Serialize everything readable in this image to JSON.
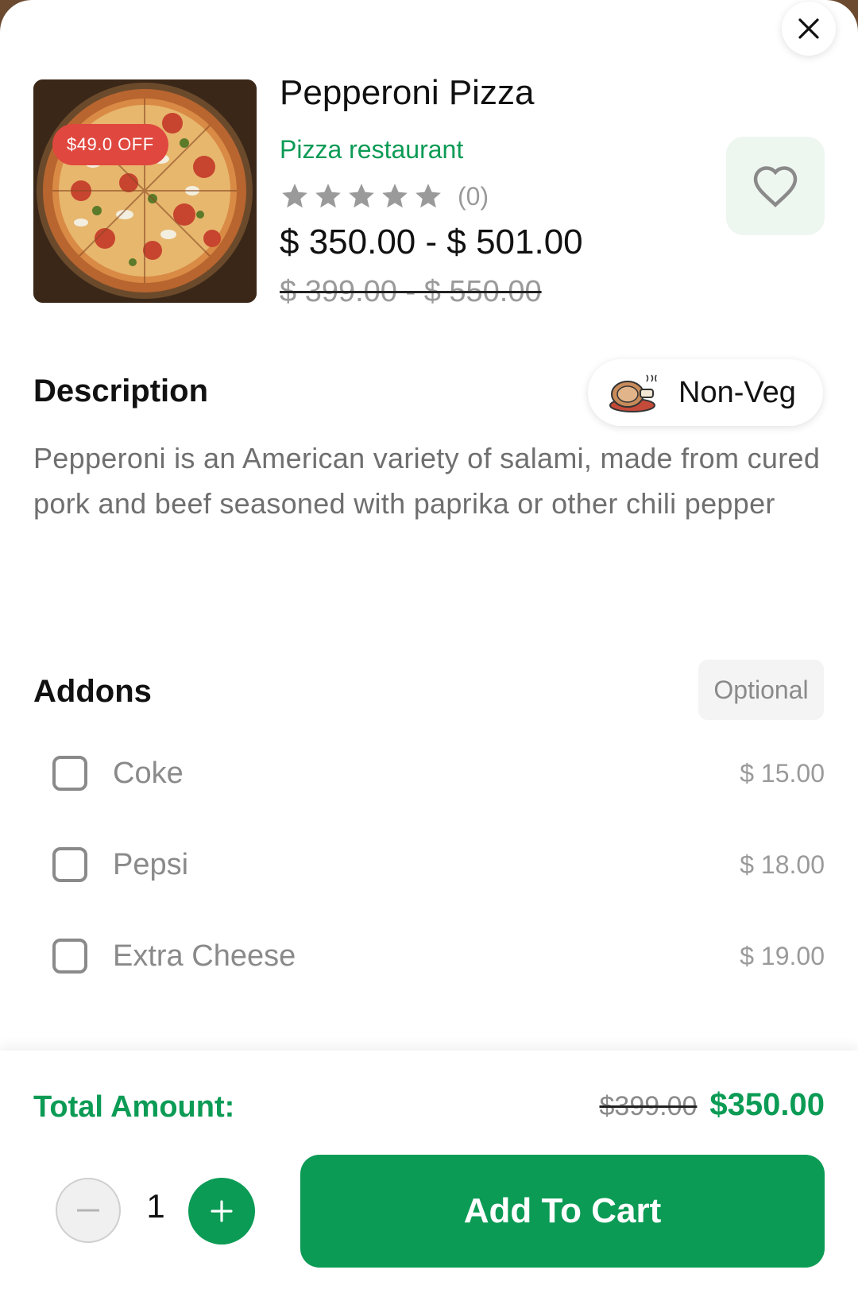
{
  "product": {
    "title": "Pepperoni Pizza",
    "restaurant": "Pizza restaurant",
    "discount_badge": "$49.0 OFF",
    "rating": 0,
    "rating_count": "(0)",
    "price_range": "$ 350.00 - $ 501.00",
    "old_price_range": "$ 399.00 - $ 550.00",
    "image_icon": "pizza-image"
  },
  "description": {
    "heading": "Description",
    "text": "Pepperoni is an American variety of salami, made from cured pork and beef seasoned with paprika or other chili pepper",
    "diet_label": "Non-Veg",
    "diet_icon": "meat-icon"
  },
  "addons": {
    "heading": "Addons",
    "tag": "Optional",
    "items": [
      {
        "name": "Coke",
        "price": "$ 15.00",
        "checked": false
      },
      {
        "name": "Pepsi",
        "price": "$ 18.00",
        "checked": false
      },
      {
        "name": "Extra Cheese",
        "price": "$ 19.00",
        "checked": false
      }
    ]
  },
  "footer": {
    "total_label": "Total Amount:",
    "total_old": "$399.00",
    "total_new": "$350.00",
    "quantity": "1",
    "add_to_cart": "Add To Cart"
  },
  "colors": {
    "accent": "#0b9b55",
    "discount": "#e0473f",
    "muted": "#8a8a8a"
  }
}
